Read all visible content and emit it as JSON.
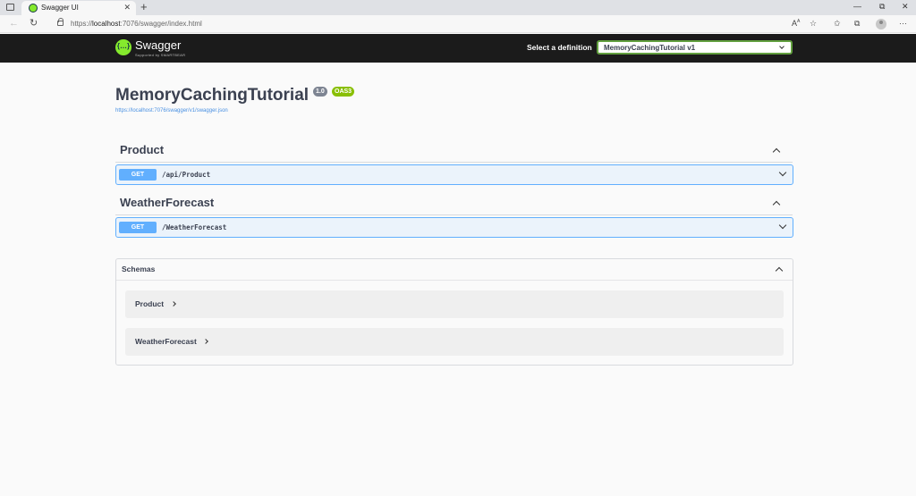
{
  "browser": {
    "tab_title": "Swagger UI",
    "tab_close": "✕",
    "new_tab": "+",
    "url_prefix": "https://",
    "url_host": "localhost",
    "url_rest": ":7076/swagger/index.html",
    "window_controls": [
      "—",
      "⧉",
      "✕"
    ]
  },
  "topbar": {
    "logo_glyph": "{…}",
    "logo_text": "Swagger",
    "logo_sub": "Supported by SMARTBEAR",
    "definition_label": "Select a definition",
    "definition_value": "MemoryCachingTutorial v1"
  },
  "info": {
    "title": "MemoryCachingTutorial",
    "version": "1.0",
    "oas": "OAS3",
    "spec_url": "https://localhost:7076/swagger/v1/swagger.json"
  },
  "tags": [
    {
      "name": "Product",
      "method": "GET",
      "path": "/api/Product"
    },
    {
      "name": "WeatherForecast",
      "method": "GET",
      "path": "/WeatherForecast"
    }
  ],
  "schemas": {
    "title": "Schemas",
    "models": [
      "Product",
      "WeatherForecast"
    ]
  },
  "colors": {
    "get": "#61affe",
    "topbar_bg": "#1b1b1b",
    "logo_green": "#85ea2d",
    "select_border": "#62a03f",
    "oas_badge": "#89bf04"
  }
}
